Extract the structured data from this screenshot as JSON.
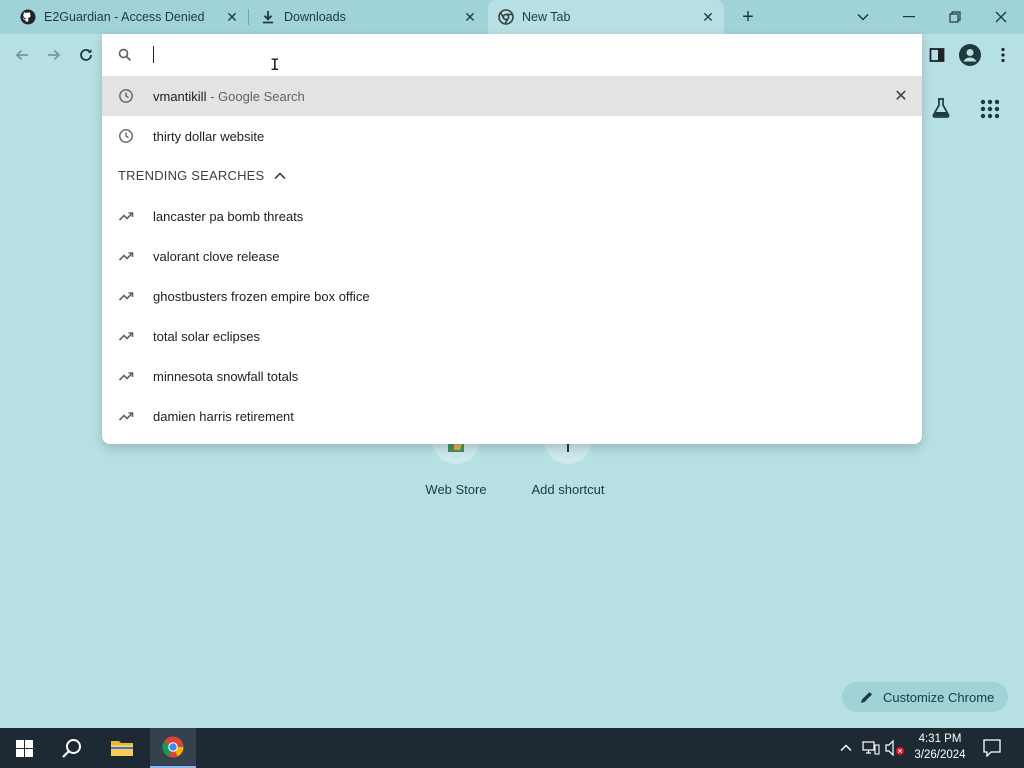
{
  "tabs": [
    {
      "title": "E2Guardian - Access Denied",
      "icon": "github-icon",
      "active": false
    },
    {
      "title": "Downloads",
      "icon": "download-icon",
      "active": false
    },
    {
      "title": "New Tab",
      "icon": "chrome-icon",
      "active": true
    }
  ],
  "omnibox": {
    "value": "",
    "suggestions": [
      {
        "text": "vmantikill",
        "subtext": "- Google Search",
        "icon": "history-icon",
        "selected": true
      },
      {
        "text": "thirty dollar website",
        "subtext": "",
        "icon": "history-icon",
        "selected": false
      }
    ],
    "trending_heading": "TRENDING SEARCHES",
    "trending": [
      "lancaster pa bomb threats",
      "valorant clove release",
      "ghostbusters frozen empire box office",
      "total solar eclipses",
      "minnesota snowfall totals",
      "damien harris retirement"
    ]
  },
  "ntp": {
    "shortcuts": [
      "Web Store",
      "Add shortcut"
    ],
    "customize_label": "Customize Chrome"
  },
  "taskbar": {
    "time": "4:31 PM",
    "date": "3/26/2024"
  },
  "colors": {
    "theme_bg": "#b7e0e4",
    "tabstrip_bg": "#9fd3d8",
    "taskbar_bg": "#1e2a33"
  }
}
